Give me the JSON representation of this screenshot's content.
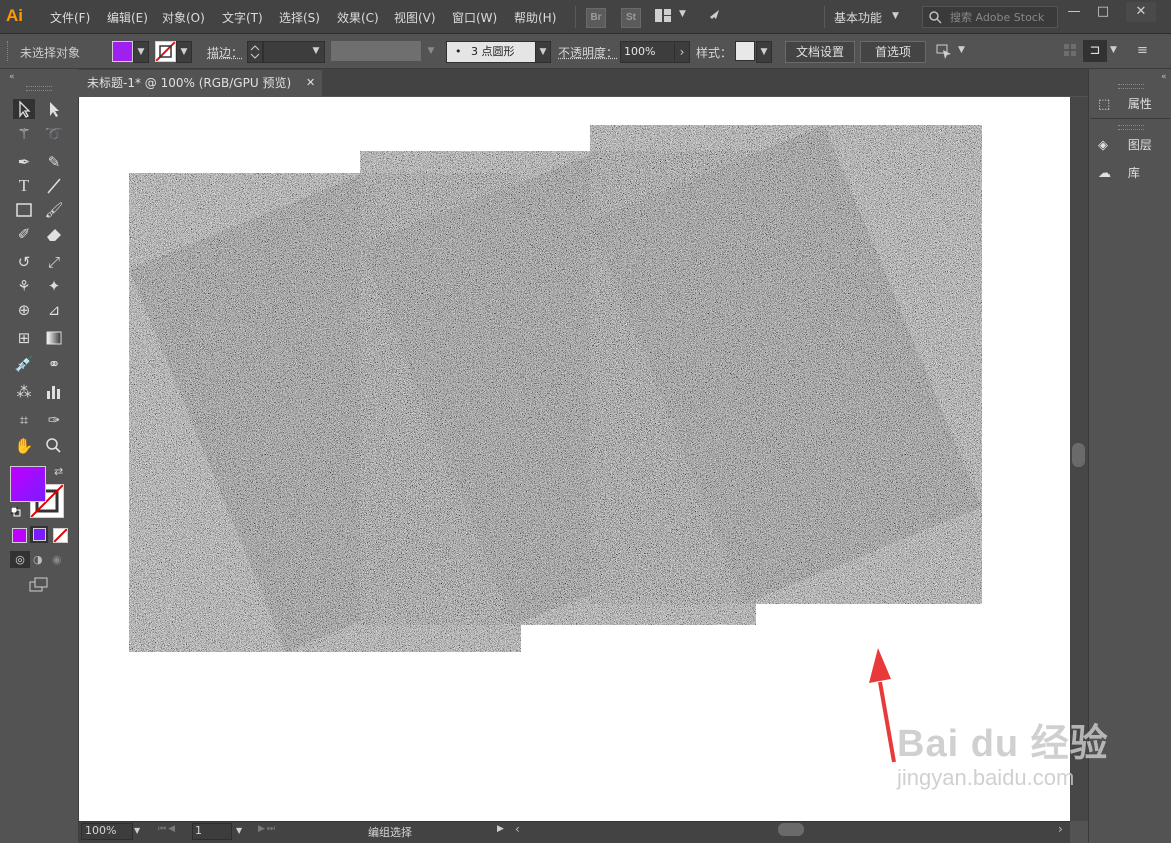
{
  "app": {
    "logo": "Ai",
    "menus": [
      "文件(F)",
      "编辑(E)",
      "对象(O)",
      "文字(T)",
      "选择(S)",
      "效果(C)",
      "视图(V)",
      "窗口(W)",
      "帮助(H)"
    ],
    "bridge": "Br",
    "stock": "St",
    "workspace": "基本功能",
    "search_placeholder": "搜索 Adobe Stock"
  },
  "control_bar": {
    "selection_status": "未选择对象",
    "stroke_label": "描边：",
    "brush": "3 点圆形",
    "opacity_label": "不透明度：",
    "opacity_value": "100%",
    "style_label": "样式：",
    "doc_setup": "文档设置",
    "preferences": "首选项"
  },
  "document": {
    "tab_title": "未标题-1* @ 100% (RGB/GPU 预览)"
  },
  "right_panels": {
    "properties": "属性",
    "layers": "图层",
    "libraries": "库"
  },
  "status": {
    "zoom": "100%",
    "artboard": "1",
    "mode": "编组选择"
  },
  "watermark": {
    "brand": "Bai du 经验",
    "url": "jingyan.baidu.com"
  },
  "colors": {
    "fill": "#a020f0",
    "accent_arrow": "#e83a3a",
    "logo": "#ff9a00"
  }
}
